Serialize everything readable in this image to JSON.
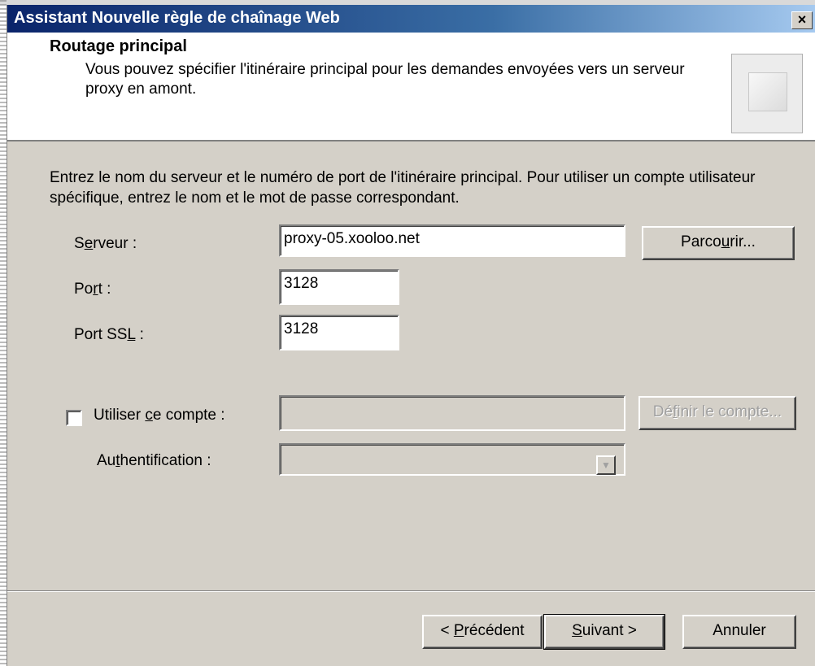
{
  "window": {
    "title": "Assistant Nouvelle règle de chaînage Web",
    "close_label": "×"
  },
  "header": {
    "title": "Routage principal",
    "description": "Vous pouvez spécifier l'itinéraire principal pour les demandes envoyées vers un serveur proxy en amont."
  },
  "instructions": "Entrez le nom du serveur et le numéro de port de l'itinéraire principal. Pour utiliser un compte utilisateur spécifique, entrez le nom et le mot de passe correspondant.",
  "fields": {
    "server": {
      "label_pre": "S",
      "label_key": "e",
      "label_post": "rveur :",
      "value": "proxy-05.xooloo.net"
    },
    "port": {
      "label_pre": "Po",
      "label_key": "r",
      "label_post": "t :",
      "value": "3128"
    },
    "port_ssl": {
      "label_pre": "Port SS",
      "label_key": "L",
      "label_post": " :",
      "value": "3128"
    }
  },
  "browse_button": {
    "pre": "Parco",
    "key": "u",
    "post": "rir..."
  },
  "use_account": {
    "pre": "Utiliser ",
    "key": "c",
    "post": "e compte :",
    "checked": false,
    "value": ""
  },
  "define_account_button": {
    "pre": "Dé",
    "key": "f",
    "post": "inir le compte...",
    "enabled": false
  },
  "authentication": {
    "pre": "Au",
    "key": "t",
    "post": "hentification :",
    "value": "",
    "enabled": false,
    "arrow": "▼"
  },
  "buttons": {
    "back": {
      "pre": "< ",
      "key": "P",
      "post": "récédent"
    },
    "next": {
      "pre": "",
      "key": "S",
      "post": "uivant >"
    },
    "cancel": {
      "label": "Annuler"
    }
  },
  "colors": {
    "title_gradient_start": "#0a246a",
    "title_gradient_end": "#a6caf0",
    "dialog_bg": "#d4d0c8"
  }
}
